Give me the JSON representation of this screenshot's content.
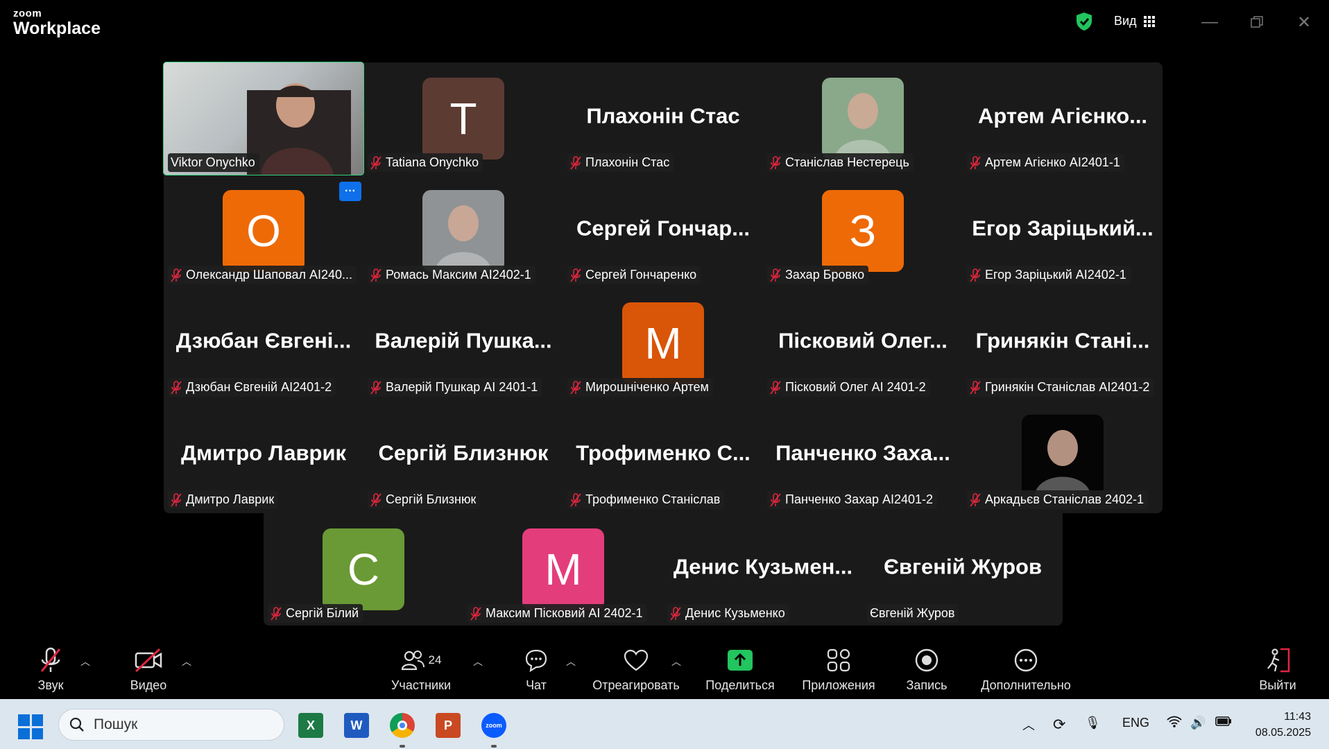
{
  "app": {
    "brand_top": "zoom",
    "brand_bottom": "Workplace"
  },
  "titlebar": {
    "view_label": "Вид"
  },
  "participants": [
    {
      "big": "",
      "tag": "Viktor Onychko",
      "muted": false,
      "type": "video"
    },
    {
      "big": "",
      "tag": "Tatiana Onychko",
      "muted": true,
      "type": "letter",
      "letter": "T",
      "color": "#5c3b33"
    },
    {
      "big": "Плахонін Стас",
      "tag": "Плахонін Стас",
      "muted": true,
      "type": "name"
    },
    {
      "big": "",
      "tag": "Станіслав Нестерець",
      "muted": true,
      "type": "photo",
      "color": "#8aa88a"
    },
    {
      "big": "Артем Агієнко...",
      "tag": "Артем Агієнко AI2401-1",
      "muted": true,
      "type": "name"
    },
    {
      "big": "",
      "tag": "Олександр Шаповал AI240...",
      "muted": true,
      "type": "letter",
      "letter": "О",
      "color": "#ee6a07"
    },
    {
      "big": "",
      "tag": "Ромась Максим AI2402-1",
      "muted": true,
      "type": "photo",
      "color": "#8f9396"
    },
    {
      "big": "Сергей  Гончар...",
      "tag": "Сергей Гончаренко",
      "muted": true,
      "type": "name"
    },
    {
      "big": "",
      "tag": "Захар Бровко",
      "muted": true,
      "type": "letter",
      "letter": "З",
      "color": "#ee6a07"
    },
    {
      "big": "Егор  Заріцький...",
      "tag": "Егор Заріцький AI2402-1",
      "muted": true,
      "type": "name"
    },
    {
      "big": "Дзюбан Євгені...",
      "tag": "Дзюбан Євгеній AI2401-2",
      "muted": true,
      "type": "name"
    },
    {
      "big": "Валерій Пушка...",
      "tag": "Валерій Пушкар AI 2401-1",
      "muted": true,
      "type": "name"
    },
    {
      "big": "",
      "tag": "Мирошніченко Артем",
      "muted": true,
      "type": "letter",
      "letter": "М",
      "color": "#d95507"
    },
    {
      "big": "Пісковий  Олег...",
      "tag": "Пісковий Олег AI 2401-2",
      "muted": true,
      "type": "name"
    },
    {
      "big": "Гринякін  Стані...",
      "tag": "Гринякін Станіслав AI2401-2",
      "muted": true,
      "type": "name"
    },
    {
      "big": "Дмитро Лаврик",
      "tag": "Дмитро Лаврик",
      "muted": true,
      "type": "name"
    },
    {
      "big": "Сергій Близнюк",
      "tag": "Сергій Близнюк",
      "muted": true,
      "type": "name"
    },
    {
      "big": "Трофименко  С...",
      "tag": "Трофименко Станіслав",
      "muted": true,
      "type": "name"
    },
    {
      "big": "Панченко  Заха...",
      "tag": "Панченко Захар AI2401-2",
      "muted": true,
      "type": "name"
    },
    {
      "big": "",
      "tag": "Аркадьєв Станіслав 2402-1",
      "muted": true,
      "type": "photo",
      "color": "#050505"
    },
    {
      "big": "",
      "tag": "Сергій Білий",
      "muted": true,
      "type": "letter",
      "letter": "С",
      "color": "#6a9a35"
    },
    {
      "big": "",
      "tag": "Максим Пісковий AI 2402-1",
      "muted": true,
      "type": "letter",
      "letter": "М",
      "color": "#e43d7c"
    },
    {
      "big": "Денис  Кузьмен...",
      "tag": "Денис Кузьменко",
      "muted": true,
      "type": "name"
    },
    {
      "big": "Євгеній Журов",
      "tag": "Євгеній Журов",
      "muted": false,
      "type": "name"
    }
  ],
  "toolbar": {
    "audio": "Звук",
    "video": "Видео",
    "participants": "Участники",
    "participants_count": "24",
    "chat": "Чат",
    "react": "Отреагировать",
    "share": "Поделиться",
    "apps": "Приложения",
    "record": "Запись",
    "more": "Дополнительно",
    "leave": "Выйти"
  },
  "taskbar": {
    "search_placeholder": "Пошук",
    "lang": "ENG",
    "time": "11:43",
    "date": "08.05.2025"
  },
  "colors": {
    "accent_green": "#2dd47e",
    "share_green": "#22c55e",
    "leave_red": "#e0263f",
    "mute_red": "#e0263f"
  }
}
